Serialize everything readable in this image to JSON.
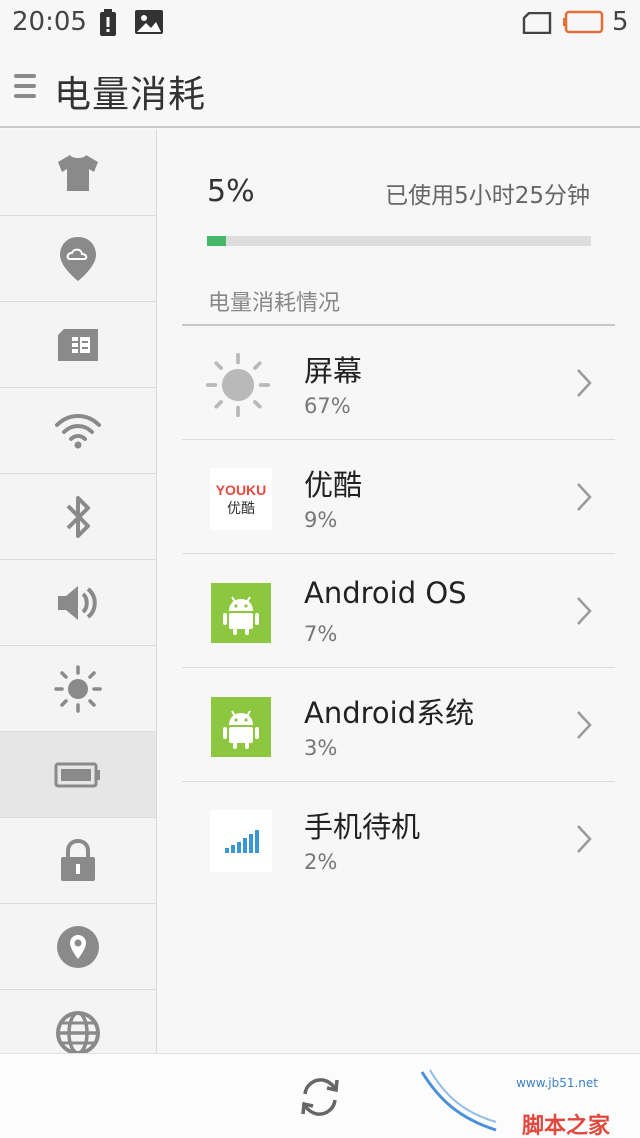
{
  "status_bar": {
    "time": "20:05",
    "battery_level": "5",
    "icons": [
      "battery-alert-icon",
      "image-icon",
      "sim-icon",
      "battery-low-icon"
    ]
  },
  "header": {
    "title": "电量消耗",
    "menu_icon": "menu-icon"
  },
  "sidebar": {
    "items": [
      {
        "icon": "theme-shirt-icon",
        "active": false
      },
      {
        "icon": "cloud-location-icon",
        "active": false
      },
      {
        "icon": "sim-card-icon",
        "active": false
      },
      {
        "icon": "wifi-icon",
        "active": false
      },
      {
        "icon": "bluetooth-icon",
        "active": false
      },
      {
        "icon": "volume-icon",
        "active": false
      },
      {
        "icon": "brightness-icon",
        "active": false
      },
      {
        "icon": "battery-icon",
        "active": true
      },
      {
        "icon": "lock-icon",
        "active": false
      },
      {
        "icon": "location-pin-icon",
        "active": false
      },
      {
        "icon": "globe-icon",
        "active": false
      }
    ]
  },
  "summary": {
    "percent": "5%",
    "used_time": "已使用5小时25分钟",
    "battery_fraction": 0.05,
    "section_label": "电量消耗情况"
  },
  "usage_list": [
    {
      "name": "屏幕",
      "percent": "67%",
      "icon": "sun-icon"
    },
    {
      "name": "优酷",
      "percent": "9%",
      "icon": "youku-icon",
      "logo_text": "YOUKU",
      "logo_sub": "优酷"
    },
    {
      "name": "Android OS",
      "percent": "7%",
      "icon": "android-icon"
    },
    {
      "name": "Android系统",
      "percent": "3%",
      "icon": "android-icon"
    },
    {
      "name": "手机待机",
      "percent": "2%",
      "icon": "signal-bars-icon"
    }
  ],
  "bottom_bar": {
    "refresh_icon": "refresh-icon",
    "watermark_text": "脚本之家",
    "watermark_sub": "www.jb51.net"
  },
  "colors": {
    "accent_green": "#46b86a",
    "android_green": "#8dc63f",
    "youku_red": "#e8483d",
    "icon_gray": "#8a8a8a",
    "status_orange": "#e2703a"
  }
}
